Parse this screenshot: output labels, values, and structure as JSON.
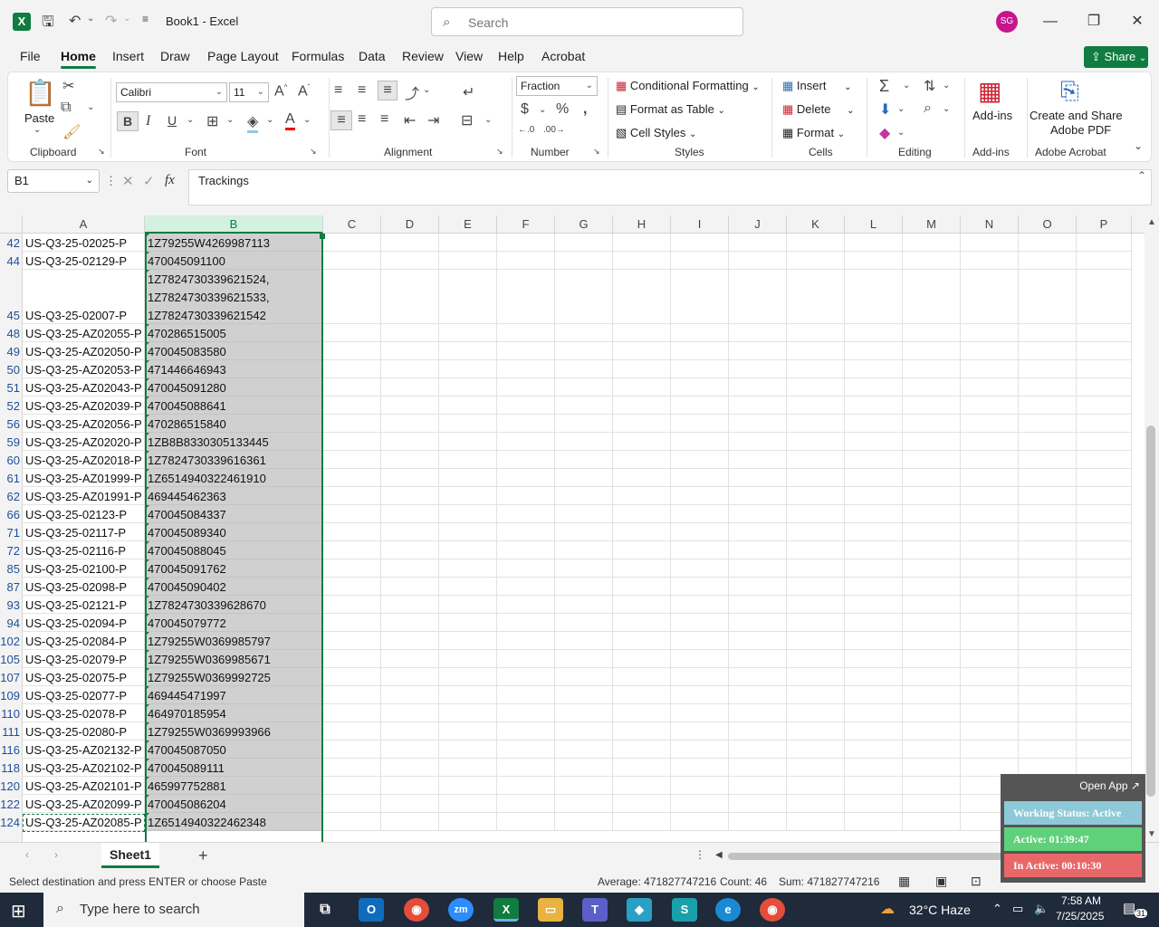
{
  "titlebar": {
    "app_logo": "X",
    "doc_title": "Book1 - Excel",
    "search_placeholder": "Search",
    "avatar_initials": "SG"
  },
  "menu": {
    "tabs": [
      "File",
      "Home",
      "Insert",
      "Draw",
      "Page Layout",
      "Formulas",
      "Data",
      "Review",
      "View",
      "Help",
      "Acrobat"
    ],
    "active": "Home",
    "share_label": "Share"
  },
  "ribbon": {
    "clipboard": {
      "paste": "Paste",
      "label": "Clipboard"
    },
    "font": {
      "name": "Calibri",
      "size": "11",
      "label": "Font"
    },
    "alignment": {
      "label": "Alignment"
    },
    "number": {
      "format": "Fraction",
      "label": "Number"
    },
    "styles": {
      "conditional": "Conditional Formatting",
      "format_table": "Format as Table",
      "cell_styles": "Cell Styles",
      "label": "Styles"
    },
    "cells": {
      "insert": "Insert",
      "delete": "Delete",
      "format": "Format",
      "label": "Cells"
    },
    "editing": {
      "label": "Editing"
    },
    "addins": {
      "button": "Add-ins",
      "label": "Add-ins"
    },
    "acrobat": {
      "button_line1": "Create and Share",
      "button_line2": "Adobe PDF",
      "label": "Adobe Acrobat"
    }
  },
  "formula_bar": {
    "name_box": "B1",
    "fx": "fx",
    "content": "Trackings"
  },
  "grid": {
    "columns": [
      "A",
      "B",
      "C",
      "D",
      "E",
      "F",
      "G",
      "H",
      "I",
      "J",
      "K",
      "L",
      "M",
      "N",
      "O",
      "P"
    ],
    "rows": [
      {
        "num": "42",
        "a": "US-Q3-25-02025-P",
        "b": "1Z79255W4269987113"
      },
      {
        "num": "44",
        "a": "US-Q3-25-02129-P",
        "b": "470045091100"
      },
      {
        "num": "45",
        "a": "US-Q3-25-02007-P",
        "b1": "1Z7824730339621524,",
        "b2": "1Z7824730339621533,",
        "b3": "1Z7824730339621542",
        "tall": true
      },
      {
        "num": "48",
        "a": "US-Q3-25-AZ02055-P",
        "b": "470286515005"
      },
      {
        "num": "49",
        "a": "US-Q3-25-AZ02050-P",
        "b": "470045083580"
      },
      {
        "num": "50",
        "a": "US-Q3-25-AZ02053-P",
        "b": "471446646943"
      },
      {
        "num": "51",
        "a": "US-Q3-25-AZ02043-P",
        "b": "470045091280"
      },
      {
        "num": "52",
        "a": "US-Q3-25-AZ02039-P",
        "b": "470045088641"
      },
      {
        "num": "56",
        "a": "US-Q3-25-AZ02056-P",
        "b": "470286515840"
      },
      {
        "num": "59",
        "a": "US-Q3-25-AZ02020-P",
        "b": "1ZB8B8330305133445"
      },
      {
        "num": "60",
        "a": "US-Q3-25-AZ02018-P",
        "b": "1Z7824730339616361"
      },
      {
        "num": "61",
        "a": "US-Q3-25-AZ01999-P",
        "b": "1Z6514940322461910"
      },
      {
        "num": "62",
        "a": "US-Q3-25-AZ01991-P",
        "b": "469445462363"
      },
      {
        "num": "66",
        "a": "US-Q3-25-02123-P",
        "b": "470045084337"
      },
      {
        "num": "71",
        "a": "US-Q3-25-02117-P",
        "b": "470045089340"
      },
      {
        "num": "72",
        "a": "US-Q3-25-02116-P",
        "b": "470045088045"
      },
      {
        "num": "85",
        "a": "US-Q3-25-02100-P",
        "b": "470045091762"
      },
      {
        "num": "87",
        "a": "US-Q3-25-02098-P",
        "b": "470045090402"
      },
      {
        "num": "93",
        "a": "US-Q3-25-02121-P",
        "b": "1Z7824730339628670"
      },
      {
        "num": "94",
        "a": "US-Q3-25-02094-P",
        "b": "470045079772"
      },
      {
        "num": "102",
        "a": "US-Q3-25-02084-P",
        "b": "1Z79255W0369985797"
      },
      {
        "num": "105",
        "a": "US-Q3-25-02079-P",
        "b": "1Z79255W0369985671"
      },
      {
        "num": "107",
        "a": "US-Q3-25-02075-P",
        "b": "1Z79255W0369992725"
      },
      {
        "num": "109",
        "a": "US-Q3-25-02077-P",
        "b": "469445471997"
      },
      {
        "num": "110",
        "a": "US-Q3-25-02078-P",
        "b": "464970185954"
      },
      {
        "num": "111",
        "a": "US-Q3-25-02080-P",
        "b": "1Z79255W0369993966"
      },
      {
        "num": "116",
        "a": "US-Q3-25-AZ02132-P",
        "b": "470045087050"
      },
      {
        "num": "118",
        "a": "US-Q3-25-AZ02102-P",
        "b": "470045089111"
      },
      {
        "num": "120",
        "a": "US-Q3-25-AZ02101-P",
        "b": "465997752881"
      },
      {
        "num": "122",
        "a": "US-Q3-25-AZ02099-P",
        "b": "470045086204"
      },
      {
        "num": "124",
        "a": "US-Q3-25-AZ02085-P",
        "b": "1Z6514940322462348"
      }
    ]
  },
  "sheets": {
    "active": "Sheet1",
    "add": "+"
  },
  "status": {
    "message": "Select destination and press ENTER or choose Paste",
    "average": "Average: 471827747216",
    "count": "Count: 46",
    "sum": "Sum: 471827747216"
  },
  "widget": {
    "open_app": "Open App ↗",
    "working_status": "Working Status: Active",
    "active": "Active: 01:39:47",
    "inactive": "In Active: 00:10:30",
    "colors": {
      "status": "#8ec9d9",
      "active": "#5fd17a",
      "inactive": "#e8686a"
    }
  },
  "taskbar": {
    "search_placeholder": "Type here to search",
    "weather": "32°C  Haze",
    "time": "7:58 AM",
    "date": "7/25/2025",
    "notifications": "31"
  },
  "colors": {
    "accent": "#107c41"
  }
}
